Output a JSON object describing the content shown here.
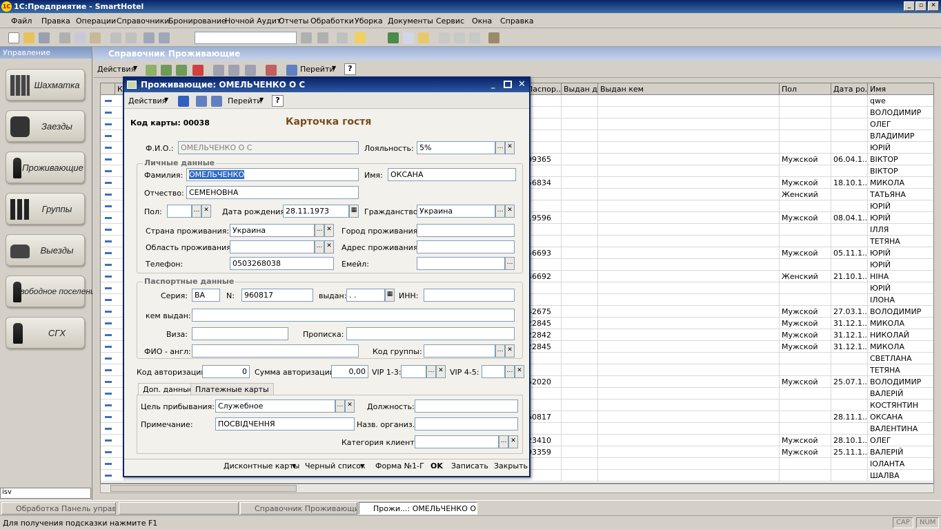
{
  "window": {
    "title": "1С:Предприятие - SmartHotel",
    "logo": "1С",
    "min": "_",
    "max": "▫",
    "close": "✕"
  },
  "menu": [
    "Файл",
    "Правка",
    "Операции",
    "Справочники",
    "Бронирование",
    "Ночной Аудит",
    "Отчеты",
    "Обработки",
    "Уборка",
    "Документы",
    "Сервис",
    "Окна",
    "Справка"
  ],
  "left_panel": {
    "header": "Управление",
    "buttons": [
      "Шахматка",
      "Заезды",
      "Проживающие",
      "Группы",
      "Выезды",
      "Свободное поселение",
      "СГХ"
    ],
    "user_box": "isv"
  },
  "list_window": {
    "title": "Справочник Проживающие",
    "actions_label": "Действия",
    "goto_label": "Перейти",
    "help": "?",
    "columns": [
      "Ко",
      "Паспор...",
      "Выдан д...",
      "Выдан кем",
      "Пол",
      "Дата ро...",
      "Имя"
    ],
    "rows": [
      {
        "p": "",
        "g": "",
        "d": "",
        "n": "qwe"
      },
      {
        "p": "",
        "g": "",
        "d": "",
        "n": "ВОЛОДИМИР"
      },
      {
        "p": "",
        "g": "",
        "d": "",
        "n": "ОЛЕГ"
      },
      {
        "p": "",
        "g": "",
        "d": "",
        "n": "ВЛАДИМИР"
      },
      {
        "p": "",
        "g": "",
        "d": "",
        "n": "ЮРІЙ"
      },
      {
        "p": "09365",
        "g": "Мужской",
        "d": "06.04.1...",
        "n": "ВІКТОР"
      },
      {
        "p": "",
        "g": "",
        "d": "",
        "n": "ВІКТОР"
      },
      {
        "p": "56834",
        "g": "Мужской",
        "d": "18.10.1...",
        "n": "МИКОЛА"
      },
      {
        "p": "",
        "g": "Женский",
        "d": "",
        "n": "ТАТЬЯНА"
      },
      {
        "p": "",
        "g": "",
        "d": "",
        "n": "ЮРІЙ"
      },
      {
        "p": "19596",
        "g": "Мужской",
        "d": "08.04.1...",
        "n": "ЮРІЙ"
      },
      {
        "p": "",
        "g": "",
        "d": "",
        "n": "ІЛЛЯ"
      },
      {
        "p": "",
        "g": "",
        "d": "",
        "n": "ТЕТЯНА"
      },
      {
        "p": "46693",
        "g": "Мужской",
        "d": "05.11.1...",
        "n": "ЮРІЙ"
      },
      {
        "p": "",
        "g": "",
        "d": "",
        "n": "ЮРІЙ"
      },
      {
        "p": "46692",
        "g": "Женский",
        "d": "21.10.1...",
        "n": "НІНА"
      },
      {
        "p": "",
        "g": "",
        "d": "",
        "n": "ЮРІЙ"
      },
      {
        "p": "",
        "g": "",
        "d": "",
        "n": "ІЛОНА"
      },
      {
        "p": "42675",
        "g": "Мужской",
        "d": "27.03.1...",
        "n": "ВОЛОДИМИР"
      },
      {
        "p": "22845",
        "g": "Мужской",
        "d": "31.12.1...",
        "n": "МИКОЛА"
      },
      {
        "p": "22842",
        "g": "Мужской",
        "d": "31.12.1...",
        "n": "НИКОЛАЙ"
      },
      {
        "p": "22845",
        "g": "Мужской",
        "d": "31.12.1...",
        "n": "МИКОЛА"
      },
      {
        "p": "",
        "g": "",
        "d": "",
        "n": "СВЕТЛАНА"
      },
      {
        "p": "",
        "g": "",
        "d": "",
        "n": "ТЕТЯНА"
      },
      {
        "p": "52020",
        "g": "Мужской",
        "d": "25.07.1...",
        "n": "ВОЛОДИМИР"
      },
      {
        "p": "",
        "g": "",
        "d": "",
        "n": "ВАЛЕРІЙ"
      },
      {
        "p": "",
        "g": "",
        "d": "",
        "n": "КОСТЯНТИН"
      },
      {
        "p": "60817",
        "g": "",
        "d": "28.11.1...",
        "n": "ОКСАНА"
      },
      {
        "p": "",
        "g": "",
        "d": "",
        "n": "ВАЛЕНТИНА"
      },
      {
        "p": "23410",
        "g": "Мужской",
        "d": "28.10.1...",
        "n": "ОЛЕГ"
      },
      {
        "p": "03359",
        "g": "Мужской",
        "d": "25.11.1...",
        "n": "ВАЛЕРІЙ"
      },
      {
        "p": "",
        "g": "",
        "d": "",
        "n": "ІОЛАНТА"
      },
      {
        "p": "",
        "g": "",
        "d": "",
        "n": "ШАЛВА"
      }
    ],
    "first_col_partial": "1"
  },
  "dialog": {
    "title": "Проживающие: ОМЕЛЬЧЕНКО О С",
    "actions_label": "Действия",
    "goto_label": "Перейти",
    "help": "?",
    "card_no_label": "Код карты: 00038",
    "heading": "Карточка гостя",
    "fio_label": "Ф.И.О.:",
    "fio_value": "ОМЕЛЬЧЕНКО О С",
    "loyalty_label": "Лояльность:",
    "loyalty_value": "5%",
    "personal_group": "Личные данные",
    "surname_label": "Фамилия:",
    "surname_value": "ОМЕЛЬЧЕНКО",
    "name_label": "Имя:",
    "name_value": "ОКСАНА",
    "patronymic_label": "Отчество:",
    "patronymic_value": "СЕМЕНОВНА",
    "sex_label": "Пол:",
    "birth_label": "Дата рождения:",
    "birth_value": "28.11.1973",
    "citizenship_label": "Гражданство:",
    "citizenship_value": "Украина",
    "country_label": "Страна проживания:",
    "country_value": "Украина",
    "city_label": "Город проживания:",
    "region_label": "Область проживания:",
    "address_label": "Адрес проживания:",
    "phone_label": "Телефон:",
    "phone_value": "0503268038",
    "email_label": "Емейл:",
    "passport_group": "Паспортные данные",
    "series_label": "Серия:",
    "series_value": "ВА",
    "number_label": "N:",
    "number_value": "960817",
    "issued_label": "выдан:",
    "issued_value": ". .",
    "inn_label": "ИНН:",
    "issuer_label": "кем выдан:",
    "visa_label": "Виза:",
    "registration_label": "Прописка:",
    "fio_en_label": "ФИО - англ:",
    "group_code_label": "Код группы:",
    "auth_code_label": "Код авторизации:",
    "auth_code_value": "0",
    "auth_sum_label": "Сумма авторизации:",
    "auth_sum_value": "0,00",
    "vip13_label": "VIP 1-3:",
    "vip45_label": "VIP 4-5:",
    "tabs": [
      "Доп. данные",
      "Платежные карты"
    ],
    "purpose_label": "Цель прибывания:",
    "purpose_value": "Служебное",
    "position_label": "Должность:",
    "note_label": "Примечание:",
    "note_value": "ПОСВІДЧЕННЯ",
    "org_label": "Назв. организ.:",
    "category_label": "Категория клиента:",
    "bottom": [
      "Дисконтные карты",
      "Черный список",
      "Форма №1-Г",
      "OK",
      "Записать",
      "Закрыть"
    ]
  },
  "taskbar": [
    "Обработка  Панель управл...",
    "",
    "Справочник Проживающие",
    "Прожи...: ОМЕЛЬЧЕНКО О С"
  ],
  "status": {
    "tip": "Для получения подсказки нажмите F1",
    "cap": "CAP",
    "num": "NUM"
  }
}
